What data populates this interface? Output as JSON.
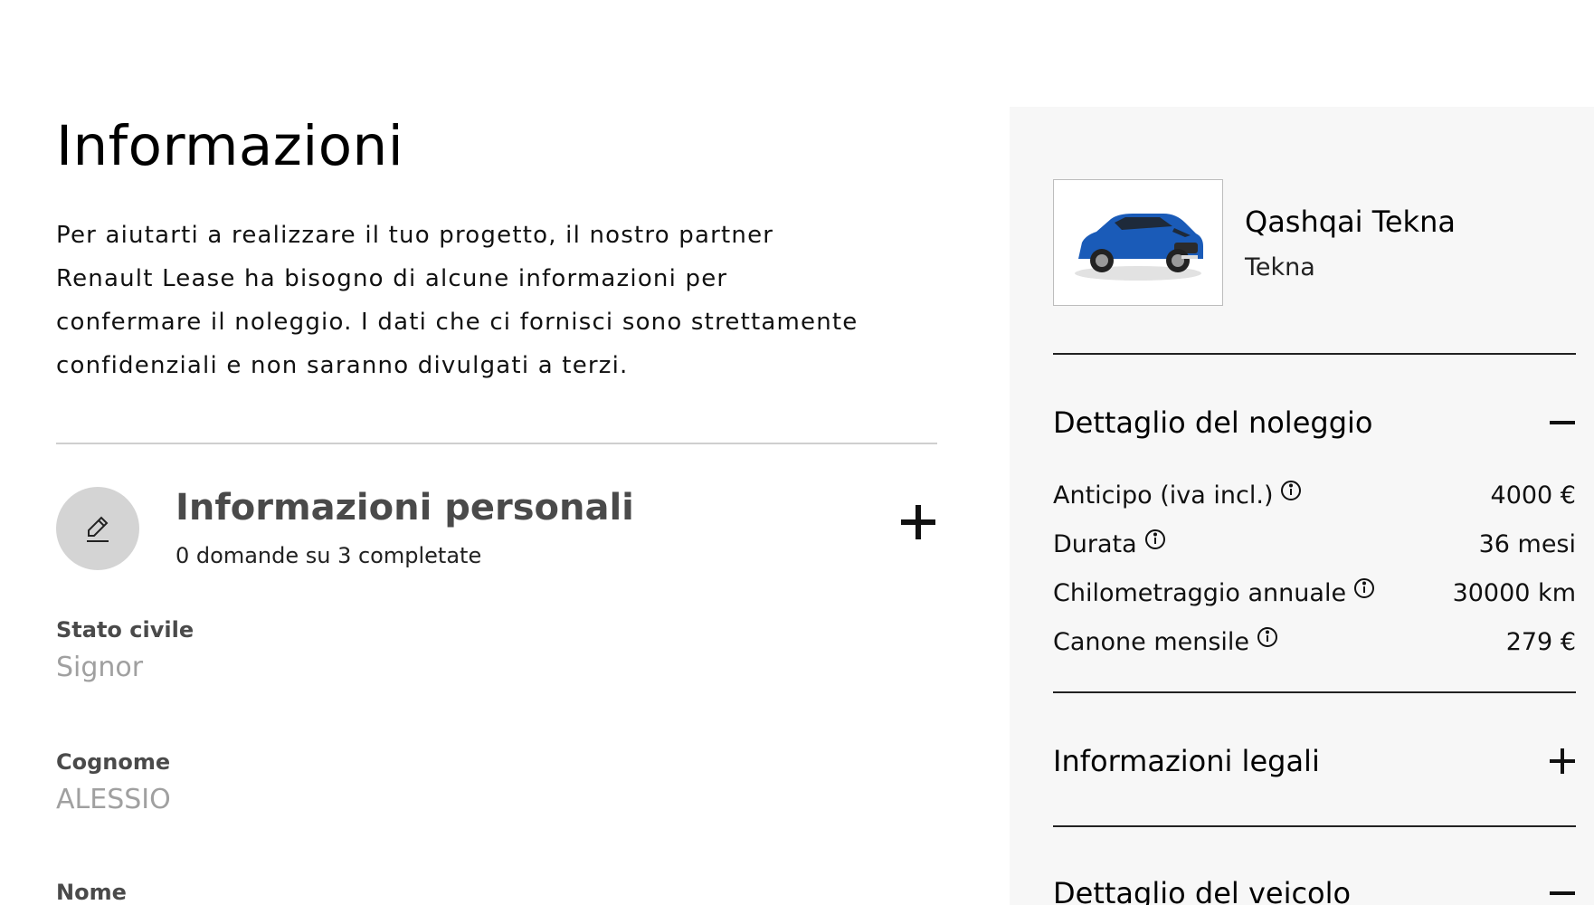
{
  "main": {
    "title": "Informazioni",
    "intro_lines": [
      "Per aiutarti a realizzare il tuo progetto, il nostro partner",
      "Renault Lease ha bisogno di alcune informazioni per",
      "confermare il noleggio. I dati che ci fornisci sono strettamente",
      "confidenziali e non saranno divulgati a terzi."
    ],
    "section": {
      "title": "Informazioni personali",
      "subtitle": "0 domande su 3 completate",
      "icon": "pencil-icon",
      "toggle_icon": "plus-icon"
    },
    "fields": [
      {
        "label": "Stato civile",
        "value": "Signor"
      },
      {
        "label": "Cognome",
        "value": "ALESSIO"
      },
      {
        "label": "Nome",
        "value": ""
      }
    ]
  },
  "summary": {
    "car": {
      "name": "Qashqai Tekna",
      "trim": "Tekna",
      "image_icon": "car-icon",
      "color": "#1a5bb8"
    },
    "rental": {
      "title": "Dettaglio del noleggio",
      "toggle_icon": "minus-icon",
      "rows": [
        {
          "label": "Anticipo (iva incl.)",
          "value": "4000 €"
        },
        {
          "label": "Durata",
          "value": "36 mesi"
        },
        {
          "label": "Chilometraggio annuale",
          "value": "30000 km"
        },
        {
          "label": "Canone mensile",
          "value": "279 €"
        }
      ]
    },
    "legal": {
      "title": "Informazioni legali",
      "toggle_icon": "plus-icon"
    },
    "vehicle": {
      "title": "Dettaglio del veicolo",
      "toggle_icon": "minus-icon"
    }
  }
}
